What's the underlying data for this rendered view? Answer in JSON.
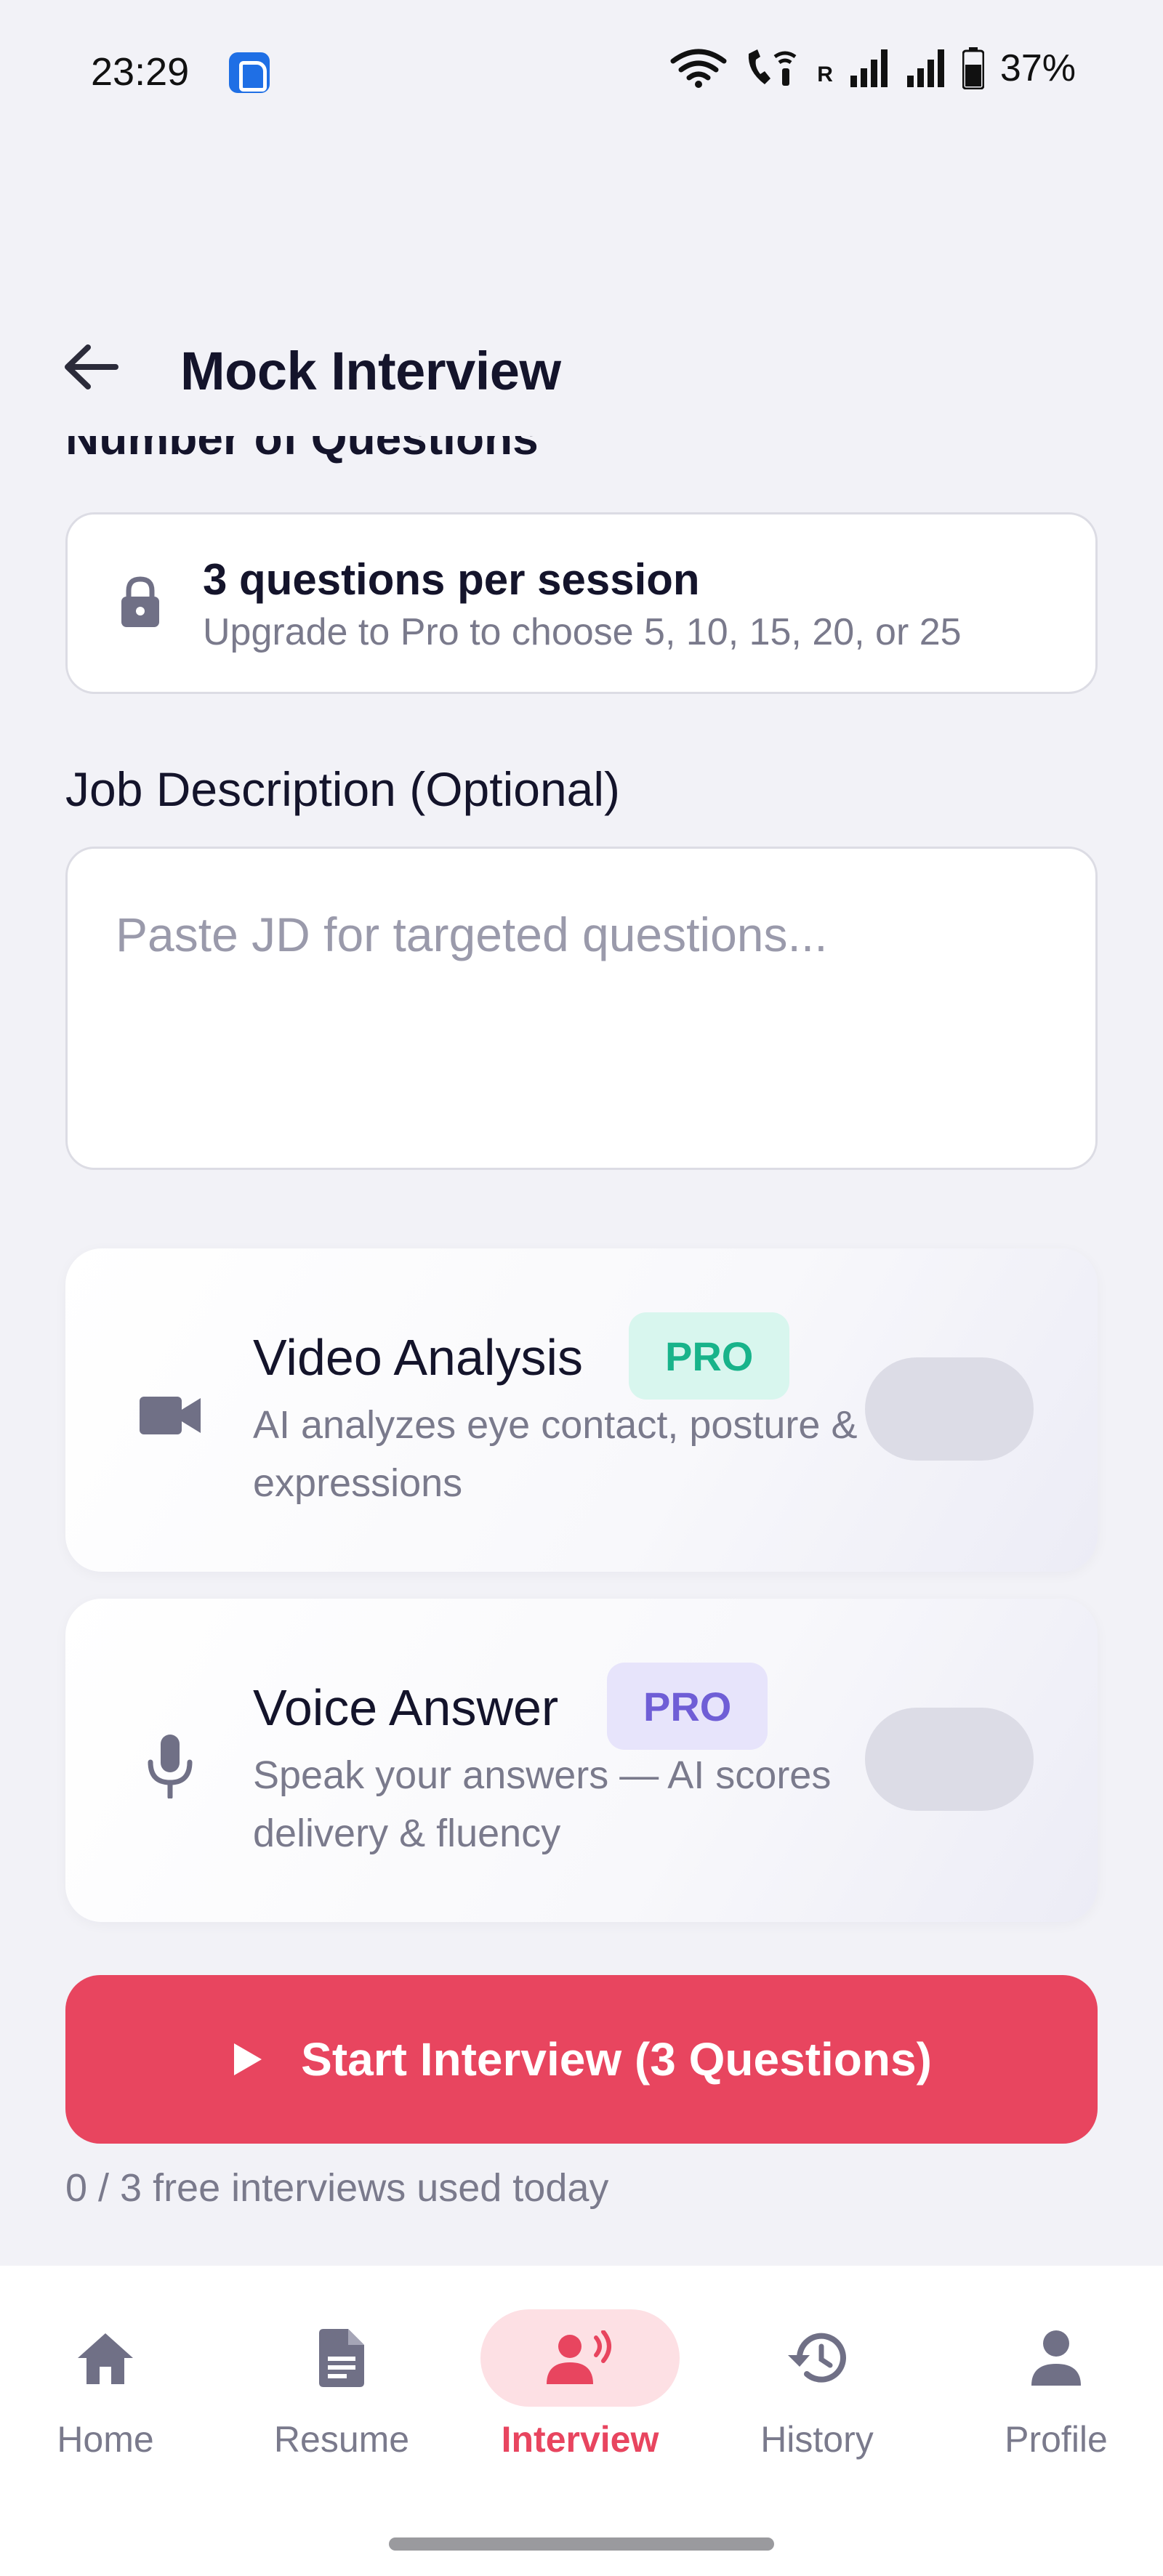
{
  "status_bar": {
    "time": "23:29",
    "carrier_mark": "R",
    "battery": "37%",
    "icons": [
      "wifi-icon",
      "wifi-call-icon",
      "signal-icon",
      "signal-icon",
      "battery-icon"
    ]
  },
  "header": {
    "title": "Mock Interview",
    "back_icon": "arrow-left-icon"
  },
  "questions_section": {
    "label": "Number of Questions",
    "title": "3 questions per session",
    "subtitle": "Upgrade to Pro to choose 5, 10, 15, 20, or 25",
    "icon": "lock-icon"
  },
  "job_description": {
    "label": "Job Description (Optional)",
    "placeholder": "Paste JD for targeted questions...",
    "value": ""
  },
  "features": {
    "video": {
      "title": "Video Analysis",
      "badge": "PRO",
      "description": "AI analyzes eye contact, posture & expressions",
      "icon": "video-camera-icon",
      "enabled": false
    },
    "voice": {
      "title": "Voice Answer",
      "badge": "PRO",
      "description": "Speak your answers — AI scores delivery & fluency",
      "icon": "microphone-icon",
      "enabled": false
    }
  },
  "start": {
    "label": "Start Interview (3 Questions)",
    "icon": "play-icon",
    "usage": "0 / 3 free interviews used today"
  },
  "nav": {
    "items": [
      {
        "label": "Home",
        "icon": "home-icon",
        "active": false
      },
      {
        "label": "Resume",
        "icon": "document-icon",
        "active": false
      },
      {
        "label": "Interview",
        "icon": "interview-speaker-icon",
        "active": true
      },
      {
        "label": "History",
        "icon": "history-icon",
        "active": false
      },
      {
        "label": "Profile",
        "icon": "person-icon",
        "active": false
      }
    ]
  },
  "colors": {
    "accent": "#e8455f",
    "accent_soft": "#fde0e4",
    "pro_green": "#18b38a",
    "pro_purple": "#6f5ed6",
    "background": "#f2f2f7"
  }
}
